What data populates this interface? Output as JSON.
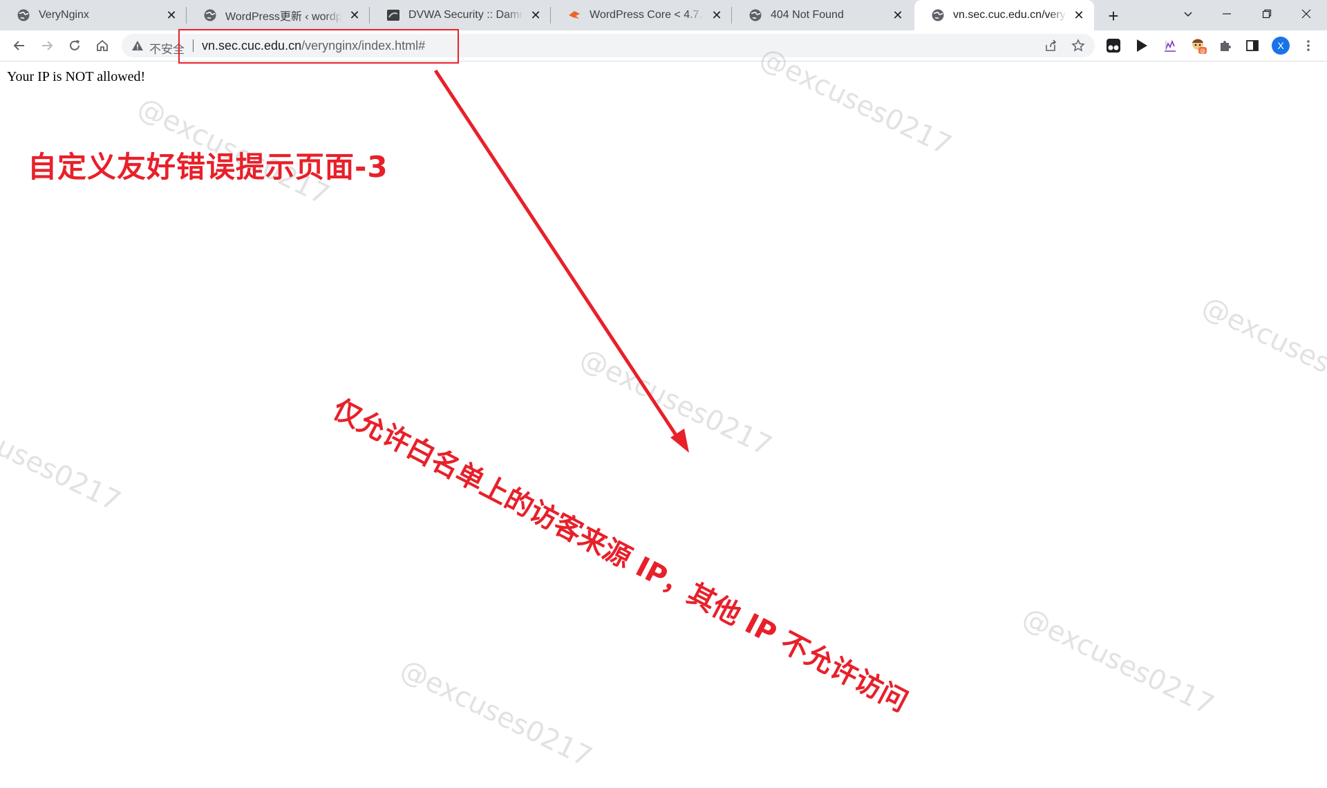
{
  "tabs": [
    {
      "title": "VeryNginx",
      "icon": "globe-icon"
    },
    {
      "title": "WordPress更新 ‹ wordpress",
      "icon": "globe-icon"
    },
    {
      "title": "DVWA Security :: Damn Vulnerable",
      "icon": "dvwa-icon"
    },
    {
      "title": "WordPress Core < 4.7.1 - User",
      "icon": "exploit-db-icon"
    },
    {
      "title": "404 Not Found",
      "icon": "globe-icon"
    },
    {
      "title": "vn.sec.cuc.edu.cn/veryngi",
      "icon": "globe-icon",
      "active": true
    }
  ],
  "tab_close_glyph": "✕",
  "new_tab_glyph": "+",
  "address_bar": {
    "security_label": "不安全",
    "url_host": "vn.sec.cuc.edu.cn",
    "url_path": "/verynginx/index.html#"
  },
  "profile": {
    "initial": "X",
    "color": "#1a73e8"
  },
  "page": {
    "message": "Your IP is NOT allowed!"
  },
  "annotations": {
    "title": "自定义友好错误提示页面-3",
    "note": "仅允许白名单上的访客来源 IP，其他 IP 不允许访问",
    "color": "#e8202a"
  },
  "watermark_text": "@excuses0217"
}
